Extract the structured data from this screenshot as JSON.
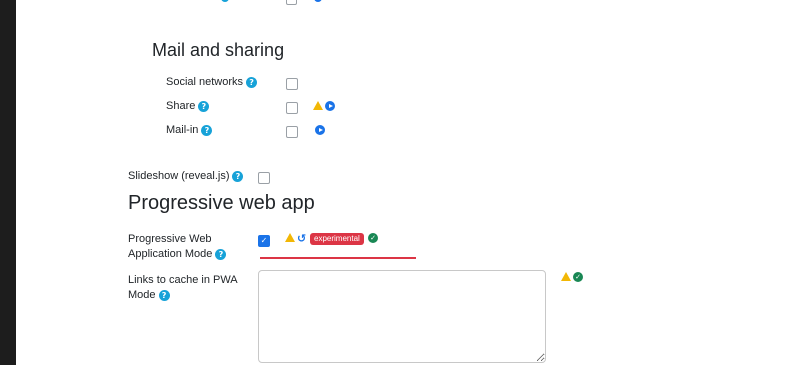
{
  "sections": {
    "mail_sharing": {
      "title": "Mail and sharing",
      "items": [
        {
          "label": "Social networks",
          "help": "?"
        },
        {
          "label": "Share",
          "help": "?"
        },
        {
          "label": "Mail-in",
          "help": "?"
        }
      ]
    },
    "slideshow": {
      "label": "Slideshow (reveal.js)",
      "help": "?"
    },
    "pwa": {
      "title": "Progressive web app",
      "mode": {
        "label_line1": "Progressive Web",
        "label_line2": "Application Mode",
        "help": "?",
        "checked": true,
        "badge": "experimental"
      },
      "links": {
        "label_line1": "Links to cache in PWA",
        "label_line2": "Mode",
        "help": "?",
        "value": ""
      }
    }
  },
  "icons": {
    "warning": "warning-icon",
    "play": "play-icon",
    "check": "check-circle-icon",
    "undo": "undo-icon",
    "help": "help-icon"
  },
  "colors": {
    "background_outer": "#1d1d1d",
    "panel": "#ffffff",
    "help": "#17a2d8",
    "primary": "#1a73e8",
    "warning": "#f2b705",
    "success": "#198754",
    "danger": "#dc3545"
  }
}
